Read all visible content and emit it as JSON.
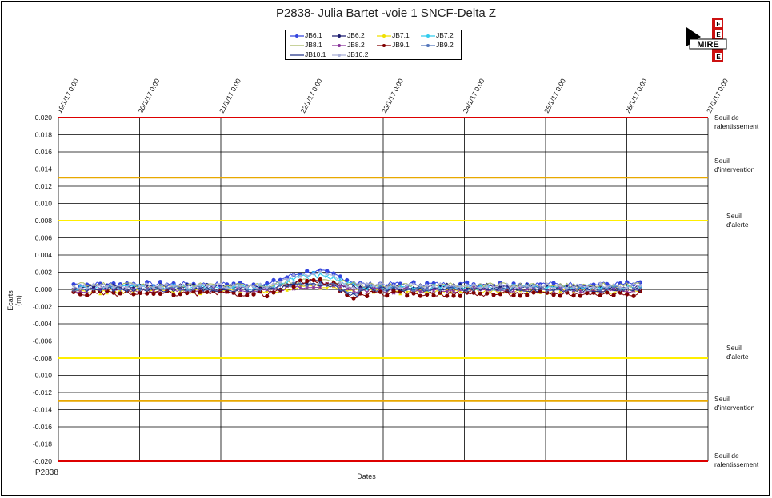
{
  "chart_data": {
    "type": "line",
    "title": "P2838- Julia Bartet -voie 1 SNCF-Delta Z",
    "xlabel": "Dates",
    "ylabel": "Ecarts (m)",
    "code_label": "P2838",
    "x_ticks": [
      "19/1/17 0:00",
      "20/1/17 0:00",
      "21/1/17 0:00",
      "22/1/17 0:00",
      "23/1/17 0:00",
      "24/1/17 0:00",
      "25/1/17 0:00",
      "26/1/17 0:00",
      "27/1/17 0:00"
    ],
    "x_range_days": [
      0,
      8
    ],
    "ylim": [
      -0.02,
      0.02
    ],
    "y_ticks": [
      "0.020",
      "0.018",
      "0.016",
      "0.014",
      "0.012",
      "0.010",
      "0.008",
      "0.006",
      "0.004",
      "0.002",
      "0.000",
      "-0.002",
      "-0.004",
      "-0.006",
      "-0.008",
      "-0.010",
      "-0.012",
      "-0.014",
      "-0.016",
      "-0.018",
      "-0.020"
    ],
    "grid": true,
    "legend_position": "top-center",
    "data_start": "19/1/17 4:30",
    "data_end": "26/1/17 4:00",
    "series": [
      {
        "name": "JB6.1",
        "color": "#3344dd",
        "marker": "circle",
        "level": 0.0006
      },
      {
        "name": "JB6.2",
        "color": "#1a1a6e",
        "marker": "diamond",
        "level": 0.0003
      },
      {
        "name": "JB7.1",
        "color": "#f0e000",
        "marker": "triangle",
        "level": -0.0002
      },
      {
        "name": "JB7.2",
        "color": "#33ccee",
        "marker": "x",
        "level": 0.0002
      },
      {
        "name": "JB8.1",
        "color": "#a8b860",
        "marker": "none",
        "level": 0.0005
      },
      {
        "name": "JB8.2",
        "color": "#883399",
        "marker": "star",
        "level": -0.0001
      },
      {
        "name": "JB9.1",
        "color": "#800000",
        "marker": "circle",
        "level": -0.0005
      },
      {
        "name": "JB9.2",
        "color": "#5577bb",
        "marker": "plus",
        "level": 0.0001
      },
      {
        "name": "JB10.1",
        "color": "#223388",
        "marker": "none",
        "level": 0.0
      },
      {
        "name": "JB10.2",
        "color": "#aab0d8",
        "marker": "diamond",
        "level": 0.0004
      }
    ],
    "thresholds": [
      {
        "value": 0.02,
        "color": "#dd0000",
        "label": [
          "Seuil de",
          "ralentissement"
        ]
      },
      {
        "value": 0.013,
        "color": "#e8a800",
        "label": [
          "Seuil",
          "d'intervention"
        ]
      },
      {
        "value": 0.008,
        "color": "#ffee00",
        "label": [
          "Seuil",
          "d'alerte"
        ]
      },
      {
        "value": -0.008,
        "color": "#ffee00",
        "label": [
          "Seuil",
          "d'alerte"
        ]
      },
      {
        "value": -0.013,
        "color": "#e8a800",
        "label": [
          "Seuil",
          "d'intervention"
        ]
      },
      {
        "value": -0.02,
        "color": "#dd0000",
        "label": [
          "Seuil de",
          "ralentissement"
        ]
      }
    ]
  },
  "logo": {
    "text": "MIRE",
    "letters": [
      "E",
      "E",
      "E"
    ]
  }
}
